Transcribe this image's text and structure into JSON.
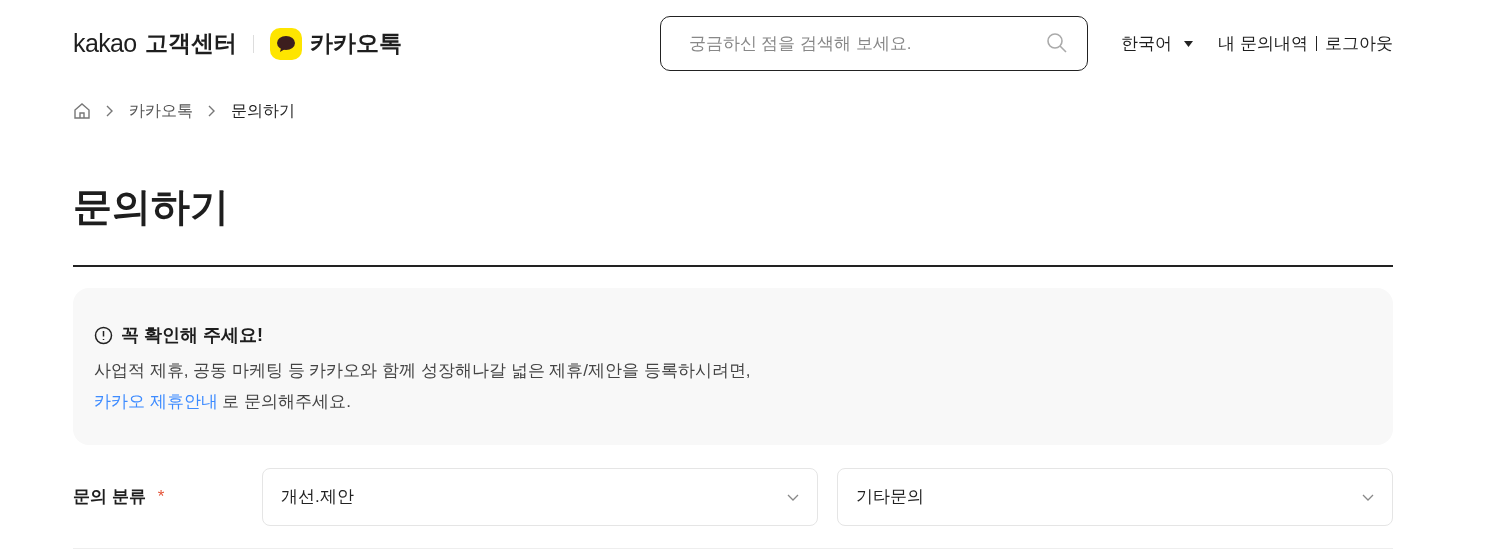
{
  "header": {
    "brand": "kakao",
    "brand_title": "고객센터",
    "service": "카카오톡",
    "search": {
      "placeholder": "궁금하신 점을 검색해 보세요."
    },
    "language": "한국어",
    "links": [
      "내 문의내역",
      "로그아웃"
    ]
  },
  "breadcrumb": [
    "카카오톡",
    "문의하기"
  ],
  "page_title": "문의하기",
  "notice": {
    "title": "꼭 확인해 주세요!",
    "text": "사업적 제휴, 공동 마케팅 등 카카오와 함께 성장해나갈 넓은 제휴/제안을 등록하시려면,",
    "link": "카카오 제휴안내",
    "text_after": " 로 문의해주세요."
  },
  "category": {
    "label": "문의 분류",
    "required_mark": "*",
    "selects": [
      {
        "value": "개선.제안"
      },
      {
        "value": "기타문의"
      }
    ]
  }
}
